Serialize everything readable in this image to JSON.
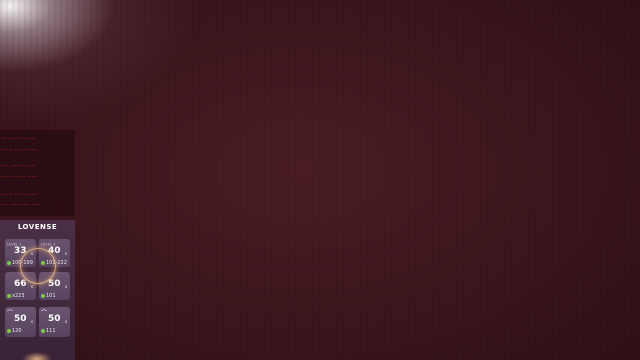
{
  "tip_overlay": {
    "lines": [
      "··· ······ ·······",
      "······ ···· ·······",
      "···· ······· ·····",
      "······· ····· ·····",
      "······ ···· ·······",
      "···· ······ ··· ·····"
    ]
  },
  "lovense": {
    "logo": "LOVENSE",
    "cards": [
      {
        "amount": "33",
        "note": "100-199",
        "level": "LEVEL 1"
      },
      {
        "amount": "40",
        "note": "101-222",
        "level": "LEVEL 2"
      },
      {
        "amount": "66",
        "note": "x223",
        "level": ""
      },
      {
        "amount": "50",
        "note": "101",
        "level": ""
      },
      {
        "amount": "50",
        "note": "120",
        "level": ""
      },
      {
        "amount": "50",
        "note": "111",
        "level": ""
      }
    ],
    "accent_color": "#7cc94a"
  },
  "colors": {
    "background": "#3a151b",
    "tip_text": "#e02020",
    "panel": "#4a2f45"
  }
}
